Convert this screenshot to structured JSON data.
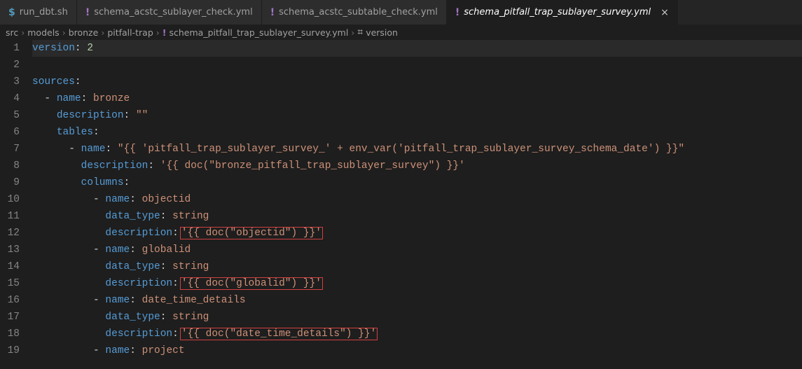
{
  "tabs": [
    {
      "icon": "$",
      "label": "run_dbt.sh",
      "active": false
    },
    {
      "icon": "!",
      "label": "schema_acstc_sublayer_check.yml",
      "active": false
    },
    {
      "icon": "!",
      "label": "schema_acstc_subtable_check.yml",
      "active": false
    },
    {
      "icon": "!",
      "label": "schema_pitfall_trap_sublayer_survey.yml",
      "active": true
    }
  ],
  "breadcrumb": {
    "parts": [
      "src",
      "models",
      "bronze",
      "pitfall-trap"
    ],
    "fileIcon": "!",
    "file": "schema_pitfall_trap_sublayer_survey.yml",
    "symbolIcon": "⌗",
    "symbol": "version"
  },
  "code": {
    "lines": [
      {
        "num": 1,
        "indent": 0,
        "tokens": [
          {
            "t": "k",
            "v": "version"
          },
          {
            "t": "p",
            "v": ": "
          },
          {
            "t": "n",
            "v": "2"
          }
        ],
        "hl": true
      },
      {
        "num": 2,
        "indent": 0,
        "tokens": []
      },
      {
        "num": 3,
        "indent": 0,
        "tokens": [
          {
            "t": "k",
            "v": "sources"
          },
          {
            "t": "p",
            "v": ":"
          }
        ]
      },
      {
        "num": 4,
        "indent": 1,
        "tokens": [
          {
            "t": "p",
            "v": "- "
          },
          {
            "t": "k",
            "v": "name"
          },
          {
            "t": "p",
            "v": ": "
          },
          {
            "t": "s",
            "v": "bronze"
          }
        ]
      },
      {
        "num": 5,
        "indent": 2,
        "tokens": [
          {
            "t": "k",
            "v": "description"
          },
          {
            "t": "p",
            "v": ": "
          },
          {
            "t": "s",
            "v": "\"\""
          }
        ]
      },
      {
        "num": 6,
        "indent": 2,
        "tokens": [
          {
            "t": "k",
            "v": "tables"
          },
          {
            "t": "p",
            "v": ":"
          }
        ]
      },
      {
        "num": 7,
        "indent": 3,
        "tokens": [
          {
            "t": "p",
            "v": "- "
          },
          {
            "t": "k",
            "v": "name"
          },
          {
            "t": "p",
            "v": ": "
          },
          {
            "t": "s",
            "v": "\"{{ 'pitfall_trap_sublayer_survey_' + env_var('pitfall_trap_sublayer_survey_schema_date') }}\""
          }
        ]
      },
      {
        "num": 8,
        "indent": 4,
        "tokens": [
          {
            "t": "k",
            "v": "description"
          },
          {
            "t": "p",
            "v": ": "
          },
          {
            "t": "s",
            "v": "'{{ doc(\"bronze_pitfall_trap_sublayer_survey\") }}'"
          }
        ]
      },
      {
        "num": 9,
        "indent": 4,
        "tokens": [
          {
            "t": "k",
            "v": "columns"
          },
          {
            "t": "p",
            "v": ":"
          }
        ]
      },
      {
        "num": 10,
        "indent": 5,
        "tokens": [
          {
            "t": "p",
            "v": "- "
          },
          {
            "t": "k",
            "v": "name"
          },
          {
            "t": "p",
            "v": ": "
          },
          {
            "t": "s",
            "v": "objectid"
          }
        ]
      },
      {
        "num": 11,
        "indent": 6,
        "tokens": [
          {
            "t": "k",
            "v": "data_type"
          },
          {
            "t": "p",
            "v": ": "
          },
          {
            "t": "s",
            "v": "string"
          }
        ]
      },
      {
        "num": 12,
        "indent": 6,
        "tokens": [
          {
            "t": "k",
            "v": "description"
          },
          {
            "t": "p",
            "v": ":"
          },
          {
            "t": "s",
            "v": "'{{ doc(\"objectid\") }}'",
            "box": true
          }
        ]
      },
      {
        "num": 13,
        "indent": 5,
        "tokens": [
          {
            "t": "p",
            "v": "- "
          },
          {
            "t": "k",
            "v": "name"
          },
          {
            "t": "p",
            "v": ": "
          },
          {
            "t": "s",
            "v": "globalid"
          }
        ]
      },
      {
        "num": 14,
        "indent": 6,
        "tokens": [
          {
            "t": "k",
            "v": "data_type"
          },
          {
            "t": "p",
            "v": ": "
          },
          {
            "t": "s",
            "v": "string"
          }
        ]
      },
      {
        "num": 15,
        "indent": 6,
        "tokens": [
          {
            "t": "k",
            "v": "description"
          },
          {
            "t": "p",
            "v": ":"
          },
          {
            "t": "s",
            "v": "'{{ doc(\"globalid\") }}'",
            "box": true
          }
        ]
      },
      {
        "num": 16,
        "indent": 5,
        "tokens": [
          {
            "t": "p",
            "v": "- "
          },
          {
            "t": "k",
            "v": "name"
          },
          {
            "t": "p",
            "v": ": "
          },
          {
            "t": "s",
            "v": "date_time_details"
          }
        ]
      },
      {
        "num": 17,
        "indent": 6,
        "tokens": [
          {
            "t": "k",
            "v": "data_type"
          },
          {
            "t": "p",
            "v": ": "
          },
          {
            "t": "s",
            "v": "string"
          }
        ]
      },
      {
        "num": 18,
        "indent": 6,
        "tokens": [
          {
            "t": "k",
            "v": "description"
          },
          {
            "t": "p",
            "v": ":"
          },
          {
            "t": "s",
            "v": "'{{ doc(\"date_time_details\") }}'",
            "box": true
          }
        ]
      },
      {
        "num": 19,
        "indent": 5,
        "tokens": [
          {
            "t": "p",
            "v": "- "
          },
          {
            "t": "k",
            "v": "name"
          },
          {
            "t": "p",
            "v": ": "
          },
          {
            "t": "s",
            "v": "project"
          }
        ]
      }
    ]
  }
}
